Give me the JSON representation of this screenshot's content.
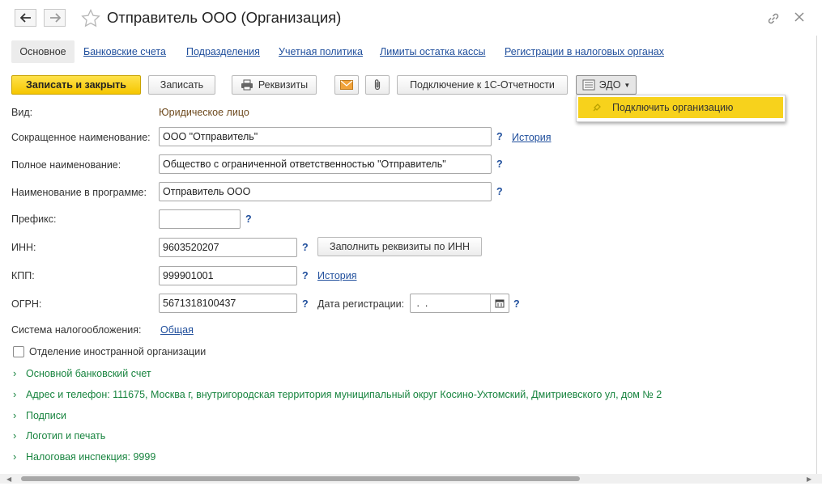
{
  "window": {
    "title": "Отправитель ООО (Организация)",
    "back_icon": "arrow-left-icon",
    "forward_icon": "arrow-right-icon",
    "favorite_icon": "star-icon",
    "link_icon": "link-icon",
    "close_icon": "close-icon",
    "more_icon": "more-vertical-icon"
  },
  "tabs": [
    {
      "label": "Основное",
      "active": true
    },
    {
      "label": "Банковские счета"
    },
    {
      "label": "Подразделения"
    },
    {
      "label": "Учетная политика"
    },
    {
      "label": "Лимиты остатка кассы"
    },
    {
      "label": "Регистрации в налоговых органах"
    }
  ],
  "toolbar": {
    "save_close": "Записать и закрыть",
    "save": "Записать",
    "requisites": "Реквизиты",
    "connect_1c": "Подключение к 1С-Отчетности",
    "edo": "ЭДО",
    "edo_menu_item": "Подключить организацию"
  },
  "form": {
    "kind_label": "Вид:",
    "kind_value": "Юридическое лицо",
    "short_name_label": "Сокращенное наименование:",
    "short_name_value": "ООО \"Отправитель\"",
    "history_link": "История",
    "full_name_label": "Полное наименование:",
    "full_name_value": "Общество с ограниченной ответственностью \"Отправитель\"",
    "program_name_label": "Наименование в программе:",
    "program_name_value": "Отправитель ООО",
    "prefix_label": "Префикс:",
    "prefix_value": "",
    "inn_label": "ИНН:",
    "inn_value": "9603520207",
    "fill_by_inn": "Заполнить реквизиты по ИНН",
    "kpp_label": "КПП:",
    "kpp_value": "999901001",
    "kpp_history": "История",
    "ogrn_label": "ОГРН:",
    "ogrn_value": "5671318100437",
    "reg_date_label": "Дата регистрации:",
    "reg_date_value": " .  .",
    "tax_system_label": "Система налогообложения:",
    "tax_system_value": "Общая",
    "foreign_branch_label": "Отделение иностранной организации",
    "help": "?"
  },
  "groups": [
    {
      "label": "Основной банковский счет"
    },
    {
      "label": "Адрес и телефон: 111675, Москва г, внутригородская территория муниципальный округ Косино-Ухтомский, Дмитриевского ул, дом № 2"
    },
    {
      "label": "Подписи"
    },
    {
      "label": "Логотип и печать"
    },
    {
      "label": "Налоговая инспекция: 9999"
    }
  ],
  "colors": {
    "accent_yellow": "#f5c600",
    "link_blue": "#1f4e9c",
    "group_green": "#18843f"
  }
}
